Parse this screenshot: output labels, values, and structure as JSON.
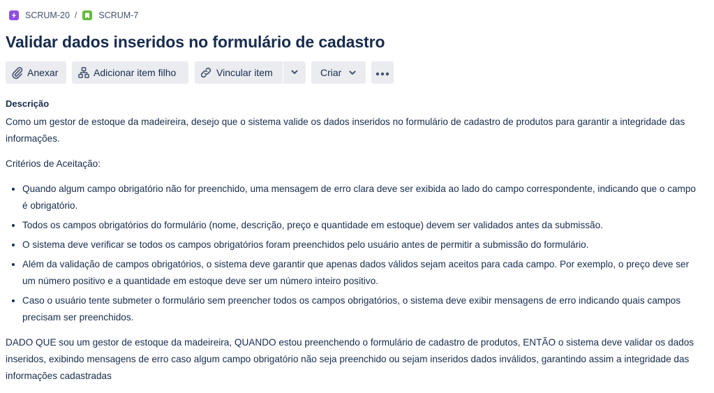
{
  "breadcrumb": {
    "parent": {
      "key": "SCRUM-20",
      "icon": "epic-icon",
      "color": "#904ee2"
    },
    "separator": "/",
    "current": {
      "key": "SCRUM-7",
      "icon": "story-icon",
      "color": "#63ba3c"
    }
  },
  "issue": {
    "title": "Validar dados inseridos no formulário de cadastro"
  },
  "toolbar": {
    "attach_label": "Anexar",
    "add_child_label": "Adicionar item filho",
    "link_label": "Vincular item",
    "create_label": "Criar",
    "button_bg": "#ebecf0"
  },
  "description": {
    "label": "Descrição",
    "intro": "Como um gestor de estoque da madeireira, desejo que o sistema valide os dados inseridos no formulário de cadastro de produtos para garantir a integridade das informações.",
    "criteria_heading": "Critérios de Aceitação:",
    "criteria": [
      "Quando algum campo obrigatório não for preenchido, uma mensagem de erro clara deve ser exibida ao lado do campo correspondente, indicando que o campo é obrigatório.",
      "Todos os campos obrigatórios do formulário (nome, descrição, preço e quantidade em estoque) devem ser validados antes da submissão.",
      "O sistema deve verificar se todos os campos obrigatórios foram preenchidos pelo usuário antes de permitir a submissão do formulário.",
      "Além da validação de campos obrigatórios, o sistema deve garantir que apenas dados válidos sejam aceitos para cada campo. Por exemplo, o preço deve ser um número positivo e a quantidade em estoque deve ser um número inteiro positivo.",
      "Caso o usuário tente submeter o formulário sem preencher todos os campos obrigatórios, o sistema deve exibir mensagens de erro indicando quais campos precisam ser preenchidos."
    ],
    "scenario": "DADO QUE sou um gestor de estoque da madeireira, QUANDO estou preenchendo o formulário de cadastro de produtos, ENTÃO o sistema deve validar os dados inseridos, exibindo mensagens de erro caso algum campo obrigatório não seja preenchido ou sejam inseridos dados inválidos, garantindo assim a integridade das informações cadastradas"
  }
}
